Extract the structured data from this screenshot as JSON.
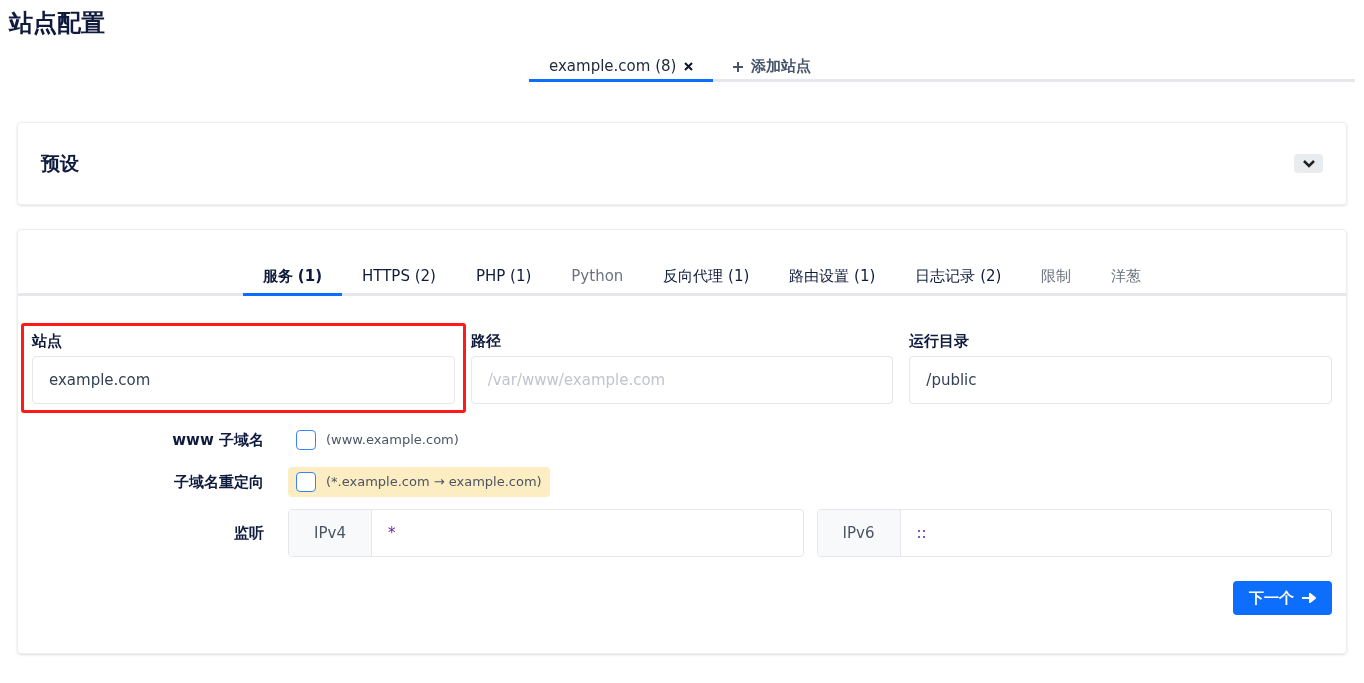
{
  "page_title": "站点配置",
  "site_tabs": [
    {
      "label": "example.com (8)",
      "selected": true,
      "closable": true
    },
    {
      "label": "添加站点",
      "selected": false,
      "closable": false,
      "kind": "add"
    }
  ],
  "preset": {
    "title": "预设",
    "expanded": false
  },
  "section_tabs": [
    {
      "label": "服务 (1)",
      "selected": true,
      "muted": false
    },
    {
      "label": "HTTPS (2)",
      "selected": false,
      "muted": false
    },
    {
      "label": "PHP (1)",
      "selected": false,
      "muted": false
    },
    {
      "label": "Python",
      "selected": false,
      "muted": true
    },
    {
      "label": "反向代理 (1)",
      "selected": false,
      "muted": false
    },
    {
      "label": "路由设置 (1)",
      "selected": false,
      "muted": false
    },
    {
      "label": "日志记录 (2)",
      "selected": false,
      "muted": false
    },
    {
      "label": "限制",
      "selected": false,
      "muted": true
    },
    {
      "label": "洋葱",
      "selected": false,
      "muted": true
    }
  ],
  "fields": [
    {
      "label": "站点",
      "value": "example.com",
      "highlighted": true
    },
    {
      "label": "路径",
      "placeholder": "/var/www/example.com",
      "highlighted": false
    },
    {
      "label": "运行目录",
      "value": "/public",
      "highlighted": false
    }
  ],
  "options": [
    {
      "label": "www 子域名",
      "hint": "(www.example.com)",
      "checked": false,
      "emphasized": false
    },
    {
      "label": "子域名重定向",
      "hint": "(*.example.com → example.com)",
      "checked": false,
      "emphasized": true
    }
  ],
  "listen": {
    "label": "监听",
    "groups": [
      {
        "prefix": "IPv4",
        "value": "*"
      },
      {
        "prefix": "IPv6",
        "value": "::"
      }
    ]
  },
  "next_button": "下一个"
}
